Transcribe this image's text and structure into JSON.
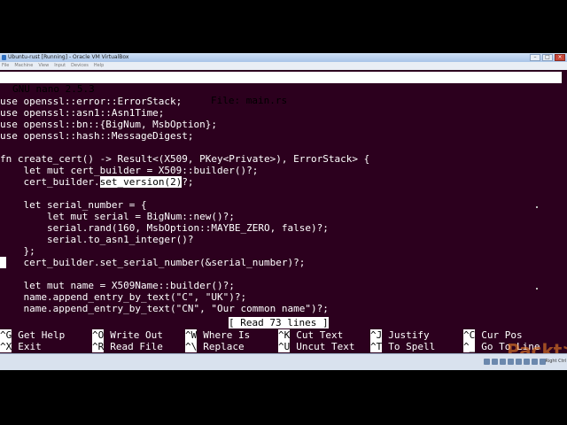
{
  "window": {
    "title": "Ubuntu-rust [Running] - Oracle VM VirtualBox",
    "menu": [
      "File",
      "Machine",
      "View",
      "Input",
      "Devices",
      "Help"
    ],
    "host_key": "Right Ctrl"
  },
  "nano": {
    "version": "GNU nano 2.5.3",
    "file_label": "File: main.rs",
    "lines": [
      "use openssl::error::ErrorStack;",
      "use openssl::asn1::Asn1Time;",
      "use openssl::bn::{BigNum, MsbOption};",
      "use openssl::hash::MessageDigest;",
      "",
      "fn create_cert() -> Result<(X509, PKey<Private>), ErrorStack> {",
      "    let mut cert_builder = X509::builder()?;",
      "    cert_builder.",
      "",
      "    let serial_number = {",
      "        let mut serial = BigNum::new()?;",
      "        serial.rand(160, MsbOption::MAYBE_ZERO, false)?;",
      "        serial.to_asn1_integer()?",
      "    };",
      "    cert_builder.set_serial_number(&serial_number)?;",
      "",
      "    let mut name = X509Name::builder()?;",
      "    name.append_entry_by_text(\"C\", \"UK\")?;",
      "    name.append_entry_by_text(\"CN\", \"Our common name\")?;"
    ],
    "selected_text": "set_version(2)",
    "after_selection": "?;",
    "status": "[ Read 73 lines ]",
    "shortcuts_row1": [
      {
        "key": "^G",
        "label": "Get Help"
      },
      {
        "key": "^O",
        "label": "Write Out"
      },
      {
        "key": "^W",
        "label": "Where Is"
      },
      {
        "key": "^K",
        "label": "Cut Text"
      },
      {
        "key": "^J",
        "label": "Justify"
      },
      {
        "key": "^C",
        "label": "Cur Pos"
      }
    ],
    "shortcuts_row2": [
      {
        "key": "^X",
        "label": "Exit"
      },
      {
        "key": "^R",
        "label": "Read File"
      },
      {
        "key": "^\\",
        "label": "Replace"
      },
      {
        "key": "^U",
        "label": "Uncut Text"
      },
      {
        "key": "^T",
        "label": "To Spell"
      },
      {
        "key": "^_",
        "label": "Go To Line"
      }
    ]
  },
  "watermark": "Packt>",
  "colors": {
    "terminal_bg": "#2c001e",
    "terminal_fg": "#ffffff"
  }
}
